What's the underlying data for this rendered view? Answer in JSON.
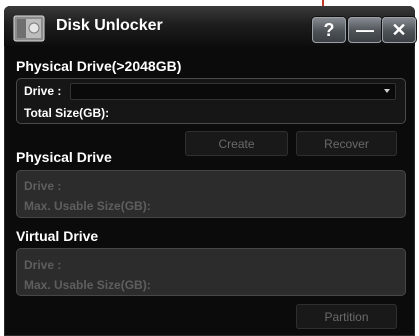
{
  "window": {
    "title": "Disk Unlocker"
  },
  "titlebar_buttons": {
    "help": "?",
    "minimize": "—",
    "close": "✕"
  },
  "large_drive": {
    "title": "Physical Drive(>2048GB)",
    "drive_label": "Drive :",
    "drive_value": "",
    "total_size_label": "Total Size(GB):"
  },
  "actions": {
    "create": "Create",
    "recover": "Recover"
  },
  "physical_drive": {
    "title": "Physical Drive",
    "drive_label": "Drive :",
    "max_size_label": "Max. Usable Size(GB):"
  },
  "virtual_drive": {
    "title": "Virtual Drive",
    "drive_label": "Drive :",
    "max_size_label": "Max. Usable Size(GB):"
  },
  "partition_button": "Partition",
  "colors": {
    "window_bg": "#0b0b0b",
    "disabled_text": "#5e5e5e",
    "accent_marker": "#c0392b"
  },
  "icons": {
    "app": "hard-disk-icon",
    "dropdown": "chevron-down-icon"
  }
}
